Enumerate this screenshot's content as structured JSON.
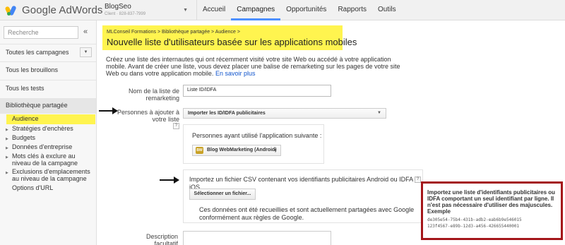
{
  "header": {
    "logo_text": "Google AdWords",
    "account_name": "BlogSeo",
    "account_id": "Client · 828-837-7999",
    "nav": [
      "Accueil",
      "Campagnes",
      "Opportunités",
      "Rapports",
      "Outils"
    ],
    "active_nav": "Campagnes",
    "icons": {
      "logo": "adwords-logo-icon",
      "account_caret": "caret-down-icon"
    }
  },
  "sidebar": {
    "search_placeholder": "Recherche",
    "collapse_icon": "«",
    "items": [
      "Toutes les campagnes",
      "Tous les brouillons",
      "Tous les tests"
    ],
    "section_title": "Bibliothèque partagée",
    "active_item": "Audience",
    "sub_items": [
      "Stratégies d'enchères",
      "Budgets",
      "Données d'entreprise",
      "Mots clés à exclure au niveau de la campagne",
      "Exclusions d'emplacements au niveau de la campagne",
      "Options d'URL"
    ]
  },
  "main": {
    "breadcrumb": "MLConseil Formations > Bibliothèque partagée > Audience >",
    "title": "Nouvelle liste d'utilisateurs basée sur les applications mobiles",
    "intro": "Créez une liste des internautes qui ont récemment visité votre site Web ou accédé à votre application mobile. Avant de créer une liste, vous devez placer une balise de remarketing sur les pages de votre site Web ou dans votre application mobile.",
    "intro_link": "En savoir plus",
    "list_name_label": "Nom de la liste de remarketing",
    "list_name_value": "Liste ID/IDFA",
    "people_label": "Personnes à ajouter à votre liste",
    "people_help": "?",
    "people_select": "Importer les ID/IDFA publicitaires",
    "app_prompt": "Personnes ayant utilisé l'application suivante :",
    "app_name": "Blog WebMarketing (Android)",
    "import_text": "Importez un fichier CSV contenant vos identifiants publicitaires Android ou IDFA iOS.",
    "import_help": "?",
    "select_file_button": "Sélectionner un fichier...",
    "data_notice": "Ces données ont été recueillies et sont actuellement partagées avec Google conformément aux règles de Google.",
    "description_label": "Description facultatif"
  },
  "callout": {
    "title": "Importez une liste d'identifiants publicitaires ou IDFA comportant un seul identifiant par ligne. Il n'est pas nécessaire d'utiliser des majuscules. Exemple",
    "examples": [
      "de305e54-75b4-431b-adb2-eab6b9e546015",
      "123f4567-e89b-12d3-a456-426655440001"
    ]
  },
  "colors": {
    "highlight": "#fff44f",
    "callout_border": "#a4161a",
    "link": "#1155cc",
    "active_tab": "#4d90fe"
  }
}
